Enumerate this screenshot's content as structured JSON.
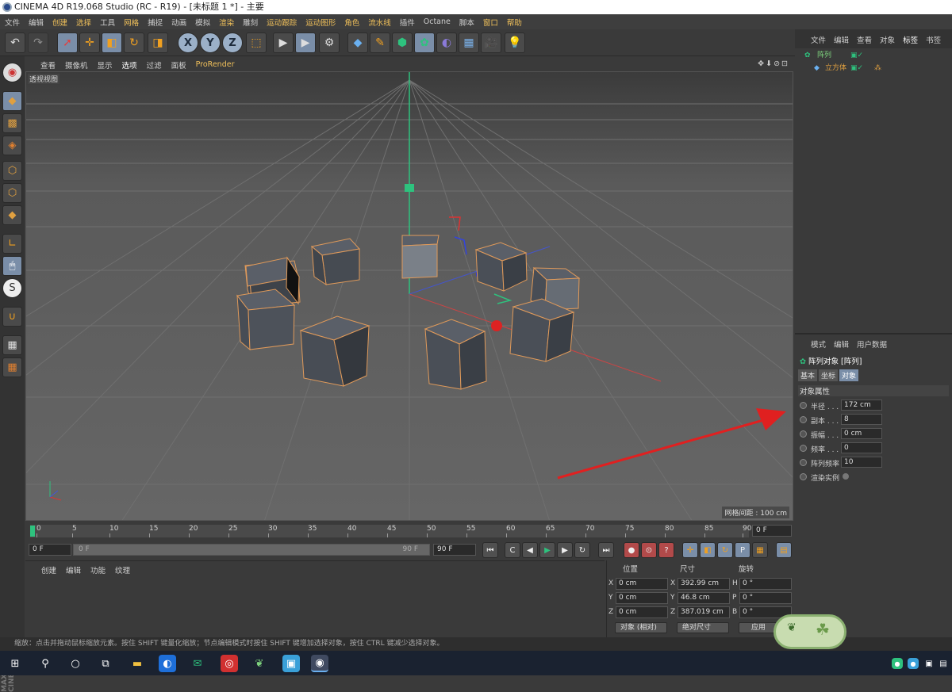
{
  "window": {
    "title": "CINEMA 4D R19.068 Studio (RC - R19) - [未标题 1 *] - 主要"
  },
  "menu": {
    "items": [
      "文件",
      "编辑",
      "创建",
      "选择",
      "工具",
      "网格",
      "捕捉",
      "动画",
      "模拟",
      "渲染",
      "雕刻",
      "运动跟踪",
      "运动图形",
      "角色",
      "流水线",
      "插件",
      "Octane",
      "脚本",
      "窗口",
      "帮助"
    ]
  },
  "viewport": {
    "menu": [
      "查看",
      "摄像机",
      "显示",
      "选项",
      "过滤",
      "面板"
    ],
    "renderer": "ProRender",
    "label": "透视视图",
    "grid_info": "网格间距 : 100 cm",
    "nav_icons": "✥⬇⊘⊡"
  },
  "timeline": {
    "ticks": [
      "0",
      "5",
      "10",
      "15",
      "20",
      "25",
      "30",
      "35",
      "40",
      "45",
      "50",
      "55",
      "60",
      "65",
      "70",
      "75",
      "80",
      "85",
      "90"
    ],
    "current_frame": "0 F",
    "start_field": "0 F",
    "slider_start": "0 F",
    "slider_end": "90 F",
    "end_field": "90 F"
  },
  "material": {
    "menu": [
      "创建",
      "编辑",
      "功能",
      "纹理"
    ]
  },
  "coords": {
    "headers": {
      "pos": "位置",
      "size": "尺寸",
      "rot": "旋转"
    },
    "rows": [
      {
        "axis": "X",
        "pos": "0 cm",
        "saxis": "X",
        "size": "392.99 cm",
        "raxis": "H",
        "rot": "0 °"
      },
      {
        "axis": "Y",
        "pos": "0 cm",
        "saxis": "Y",
        "size": "46.8 cm",
        "raxis": "P",
        "rot": "0 °"
      },
      {
        "axis": "Z",
        "pos": "0 cm",
        "saxis": "Z",
        "size": "387.019 cm",
        "raxis": "B",
        "rot": "0 °"
      }
    ],
    "mode_select": "对象 (相对)",
    "size_select": "绝对尺寸",
    "apply": "应用"
  },
  "objects": {
    "menu": [
      "文件",
      "编辑",
      "查看",
      "对象",
      "标签",
      "书签"
    ],
    "items": [
      {
        "name": "阵列",
        "color": "#7ed37e"
      },
      {
        "name": "立方体",
        "color": "#e0a040"
      }
    ]
  },
  "attributes": {
    "menu": [
      "模式",
      "编辑",
      "用户数据"
    ],
    "title": "阵列对象 [阵列]",
    "tabs": [
      "基本",
      "坐标",
      "对象"
    ],
    "section": "对象属性",
    "rows": [
      {
        "label": "半径 . . .",
        "value": "172 cm"
      },
      {
        "label": "副本 . . .",
        "value": "8"
      },
      {
        "label": "振幅 . . .",
        "value": "0 cm"
      },
      {
        "label": "频率 . . .",
        "value": "0"
      },
      {
        "label": "阵列频率",
        "value": "10"
      },
      {
        "label": "渲染实例",
        "value": ""
      }
    ]
  },
  "status": {
    "text": "缩放：点击并拖动鼠标缩放元素。按住 SHIFT 键量化缩放；节点编辑模式时按住 SHIFT 键增加选择对象，按住 CTRL 键减少选择对象。"
  },
  "branding": {
    "maxon": "MAXON CINEMA 4D"
  },
  "colors": {
    "accent": "#7a8ea8",
    "highlight_menu": "#f0c05a"
  }
}
